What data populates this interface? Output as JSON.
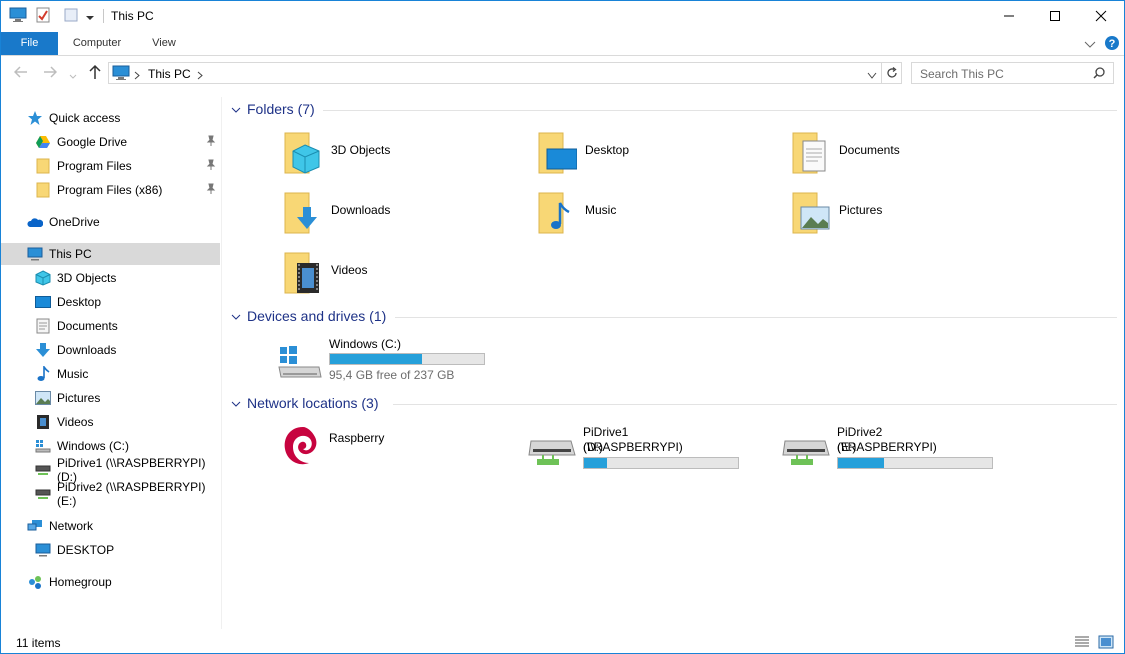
{
  "titlebar": {
    "title": "This PC"
  },
  "ribbon": {
    "tabs": [
      "File",
      "Computer",
      "View"
    ]
  },
  "address": {
    "path": "This PC",
    "search_placeholder": "Search This PC"
  },
  "nav": {
    "quick_access": "Quick access",
    "quick_items": [
      "Google Drive",
      "Program Files",
      "Program Files (x86)"
    ],
    "onedrive": "OneDrive",
    "this_pc": "This PC",
    "pc_items": [
      "3D Objects",
      "Desktop",
      "Documents",
      "Downloads",
      "Music",
      "Pictures",
      "Videos",
      "Windows (C:)",
      "PiDrive1 (\\\\RASPBERRYPI) (D:)",
      "PiDrive2 (\\\\RASPBERRYPI) (E:)"
    ],
    "network": "Network",
    "network_items": [
      "DESKTOP"
    ],
    "homegroup": "Homegroup"
  },
  "groups": {
    "folders": "Folders (7)",
    "devices": "Devices and drives (1)",
    "network": "Network locations (3)"
  },
  "folders": [
    "3D Objects",
    "Desktop",
    "Documents",
    "Downloads",
    "Music",
    "Pictures",
    "Videos"
  ],
  "drives": [
    {
      "name": "Windows (C:)",
      "free": "95,4 GB free of 237 GB",
      "used_fraction": 0.6
    }
  ],
  "network_locations": [
    {
      "name": "Raspberry"
    },
    {
      "name_line1": "PiDrive1 (\\\\RASPBERRYPI)",
      "name_line2": "(D:)",
      "used_fraction": 0.15
    },
    {
      "name_line1": "PiDrive2 (\\\\RASPBERRYPI)",
      "name_line2": "(E:)",
      "used_fraction": 0.3
    }
  ],
  "status": {
    "items": "11 items"
  },
  "colors": {
    "accent": "#1979ca",
    "group_heading": "#1e3287",
    "bar_fill": "#26a0da",
    "selection": "#d9d9d9"
  }
}
